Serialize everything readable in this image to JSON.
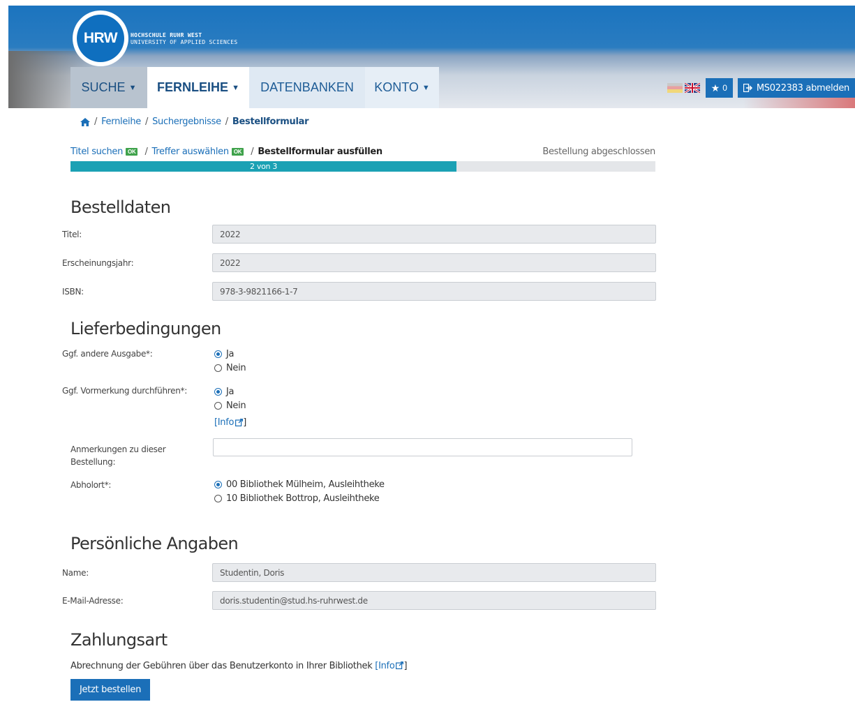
{
  "header": {
    "logo_abbr": "HRW",
    "logo_line1": "HOCHSCHULE RUHR WEST",
    "logo_line2": "UNIVERSITY OF APPLIED SCIENCES"
  },
  "nav": {
    "suche": "SUCHE",
    "fernleihe": "FERNLEIHE",
    "datenbanken": "DATENBANKEN",
    "konto": "KONTO"
  },
  "topbar": {
    "favorites_count": "0",
    "logout_label": "MS022383 abmelden"
  },
  "breadcrumb": {
    "fernleihe": "Fernleihe",
    "suchergebnisse": "Suchergebnisse",
    "current": "Bestellformular"
  },
  "steps": {
    "step1": "Titel suchen",
    "step2": "Treffer auswählen",
    "step3": "Bestellformular ausfüllen",
    "step4": "Bestellung abgeschlossen",
    "ok_badge": "OK",
    "progress_text": "2 von 3",
    "progress_fraction": 0.66
  },
  "bestelldaten": {
    "heading": "Bestelldaten",
    "titel_label": "Titel:",
    "titel_value": "2022",
    "jahr_label": "Erscheinungsjahr:",
    "jahr_value": "2022",
    "isbn_label": "ISBN:",
    "isbn_value": "978-3-9821166-1-7"
  },
  "lieferbedingungen": {
    "heading": "Lieferbedingungen",
    "ausgabe_label": "Ggf. andere Ausgabe*:",
    "ausgabe_ja": "Ja",
    "ausgabe_nein": "Nein",
    "vormerkung_label": "Ggf. Vormerkung durchführen*:",
    "vormerkung_ja": "Ja",
    "vormerkung_nein": "Nein",
    "info_link": "[Info",
    "info_close": "]",
    "anmerkungen_label_1": "Anmerkungen zu dieser",
    "anmerkungen_label_2": "Bestellung:",
    "anmerkungen_value": "",
    "abholort_label": "Abholort*:",
    "abholort_option1": "00 Bibliothek Mülheim, Ausleihtheke",
    "abholort_option2": "10 Bibliothek Bottrop, Ausleihtheke"
  },
  "persoenlich": {
    "heading": "Persönliche Angaben",
    "name_label": "Name:",
    "name_value": "Studentin, Doris",
    "email_label": "E-Mail-Adresse:",
    "email_value": "doris.studentin@stud.hs-ruhrwest.de"
  },
  "zahlungsart": {
    "heading": "Zahlungsart",
    "text": "Abrechnung der Gebühren über das Benutzerkonto in Ihrer Bibliothek ",
    "info_link": "[Info",
    "info_close": "]",
    "submit_label": "Jetzt bestellen"
  }
}
